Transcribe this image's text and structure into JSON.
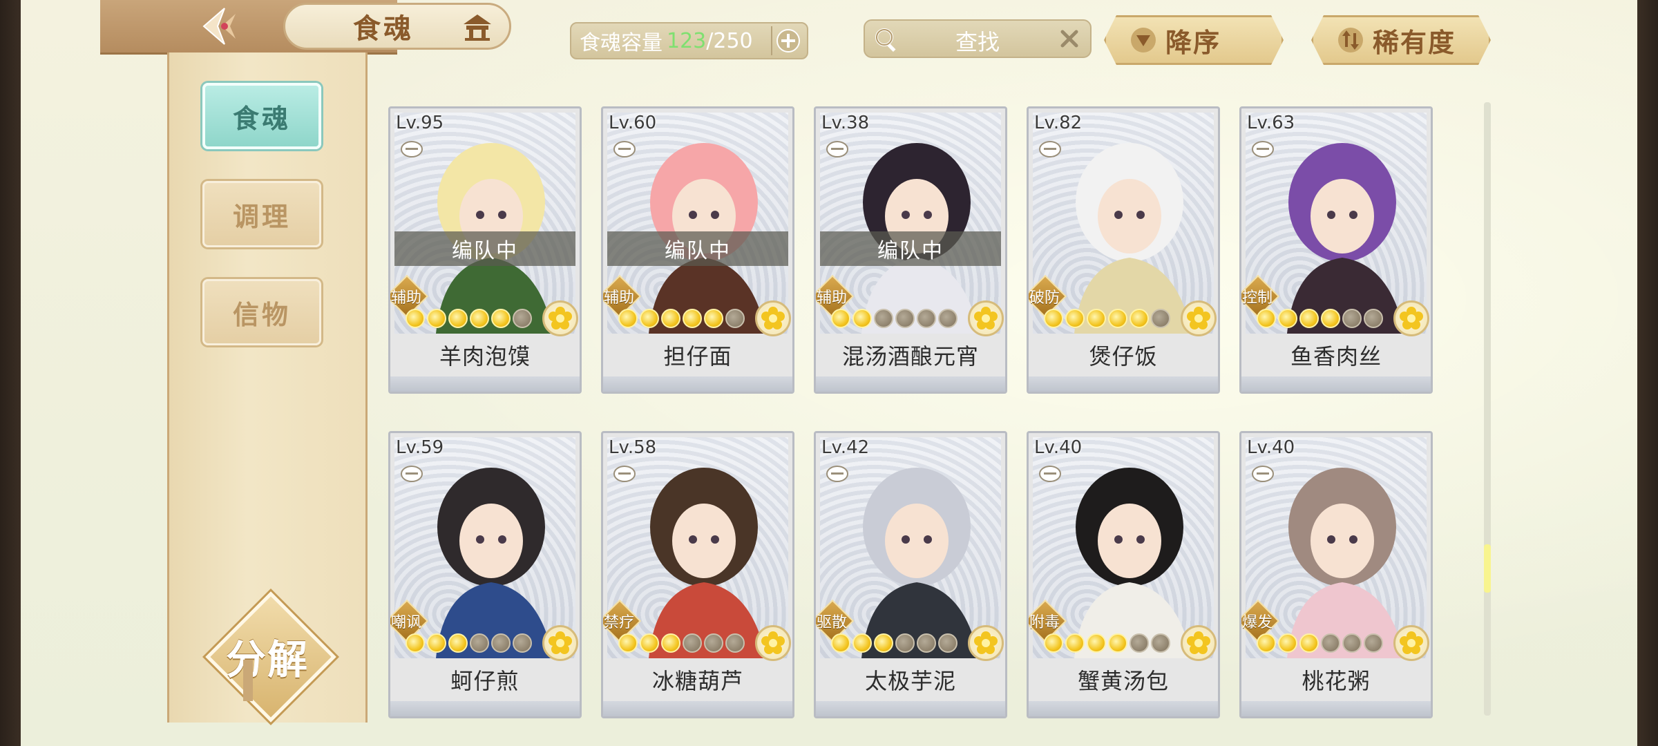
{
  "header": {
    "title": "食魂",
    "capacity_label": "食魂容量",
    "capacity_current": "123",
    "capacity_separator": "/",
    "capacity_max": "250",
    "search_placeholder": "查找",
    "sort_order_label": "降序",
    "sort_rarity_label": "稀有度"
  },
  "sidebar": {
    "tabs": [
      {
        "label": "食魂",
        "active": true
      },
      {
        "label": "调理",
        "active": false
      },
      {
        "label": "信物",
        "active": false
      }
    ],
    "decompose_label": "分解"
  },
  "cards": [
    {
      "level": "Lv.95",
      "team": "编队中",
      "role": "辅助",
      "stars": 5,
      "name": "羊肉泡馍"
    },
    {
      "level": "Lv.60",
      "team": "编队中",
      "role": "辅助",
      "stars": 5,
      "name": "担仔面"
    },
    {
      "level": "Lv.38",
      "team": "编队中",
      "role": "辅助",
      "stars": 2,
      "name": "混汤酒酿元宵"
    },
    {
      "level": "Lv.82",
      "team": "",
      "role": "破防",
      "stars": 5,
      "name": "煲仔饭"
    },
    {
      "level": "Lv.63",
      "team": "",
      "role": "控制",
      "stars": 4,
      "name": "鱼香肉丝"
    },
    {
      "level": "Lv.59",
      "team": "",
      "role": "嘲讽",
      "stars": 3,
      "name": "蚵仔煎"
    },
    {
      "level": "Lv.58",
      "team": "",
      "role": "禁疗",
      "stars": 3,
      "name": "冰糖葫芦"
    },
    {
      "level": "Lv.42",
      "team": "",
      "role": "驱散",
      "stars": 3,
      "name": "太极芋泥"
    },
    {
      "level": "Lv.40",
      "team": "",
      "role": "附毒",
      "stars": 4,
      "name": "蟹黄汤包"
    },
    {
      "level": "Lv.40",
      "team": "",
      "role": "爆发",
      "stars": 3,
      "name": "桃花粥"
    }
  ],
  "colors": {
    "accent_teal": "#8fd6ca",
    "gold": "#d9a94e",
    "capacity_green": "#7fe070",
    "scroll_thumb": "#f8f48e"
  },
  "icons": {
    "back": "back-arrow-icon",
    "home": "pavilion-icon",
    "search": "magnifier-icon",
    "clear": "close-icon",
    "add": "plus-icon",
    "sort_order": "triangle-down-icon",
    "sort_rarity": "swap-icon",
    "rarity": "flower-icon"
  }
}
